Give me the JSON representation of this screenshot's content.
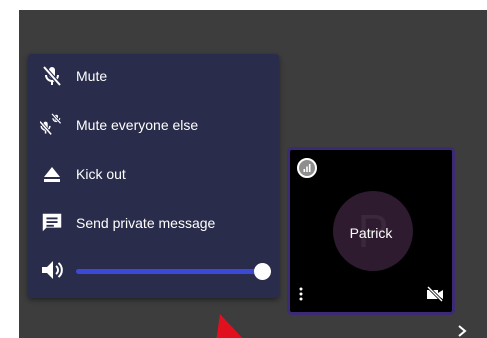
{
  "menu": {
    "items": [
      {
        "label": "Mute",
        "icon": "mic-off-icon"
      },
      {
        "label": "Mute everyone else",
        "icon": "mute-others-icon"
      },
      {
        "label": "Kick out",
        "icon": "eject-icon"
      },
      {
        "label": "Send private message",
        "icon": "message-icon"
      }
    ],
    "volume": {
      "icon": "volume-icon",
      "level_percent": 100
    }
  },
  "tile": {
    "name": "Patrick",
    "avatar_initial": "P",
    "border_color": "#3c2a77"
  },
  "colors": {
    "stage_bg": "#3d3d3d",
    "menu_bg": "#292c4a",
    "slider_fill": "#3c49d6",
    "pointer": "#e0101e"
  }
}
